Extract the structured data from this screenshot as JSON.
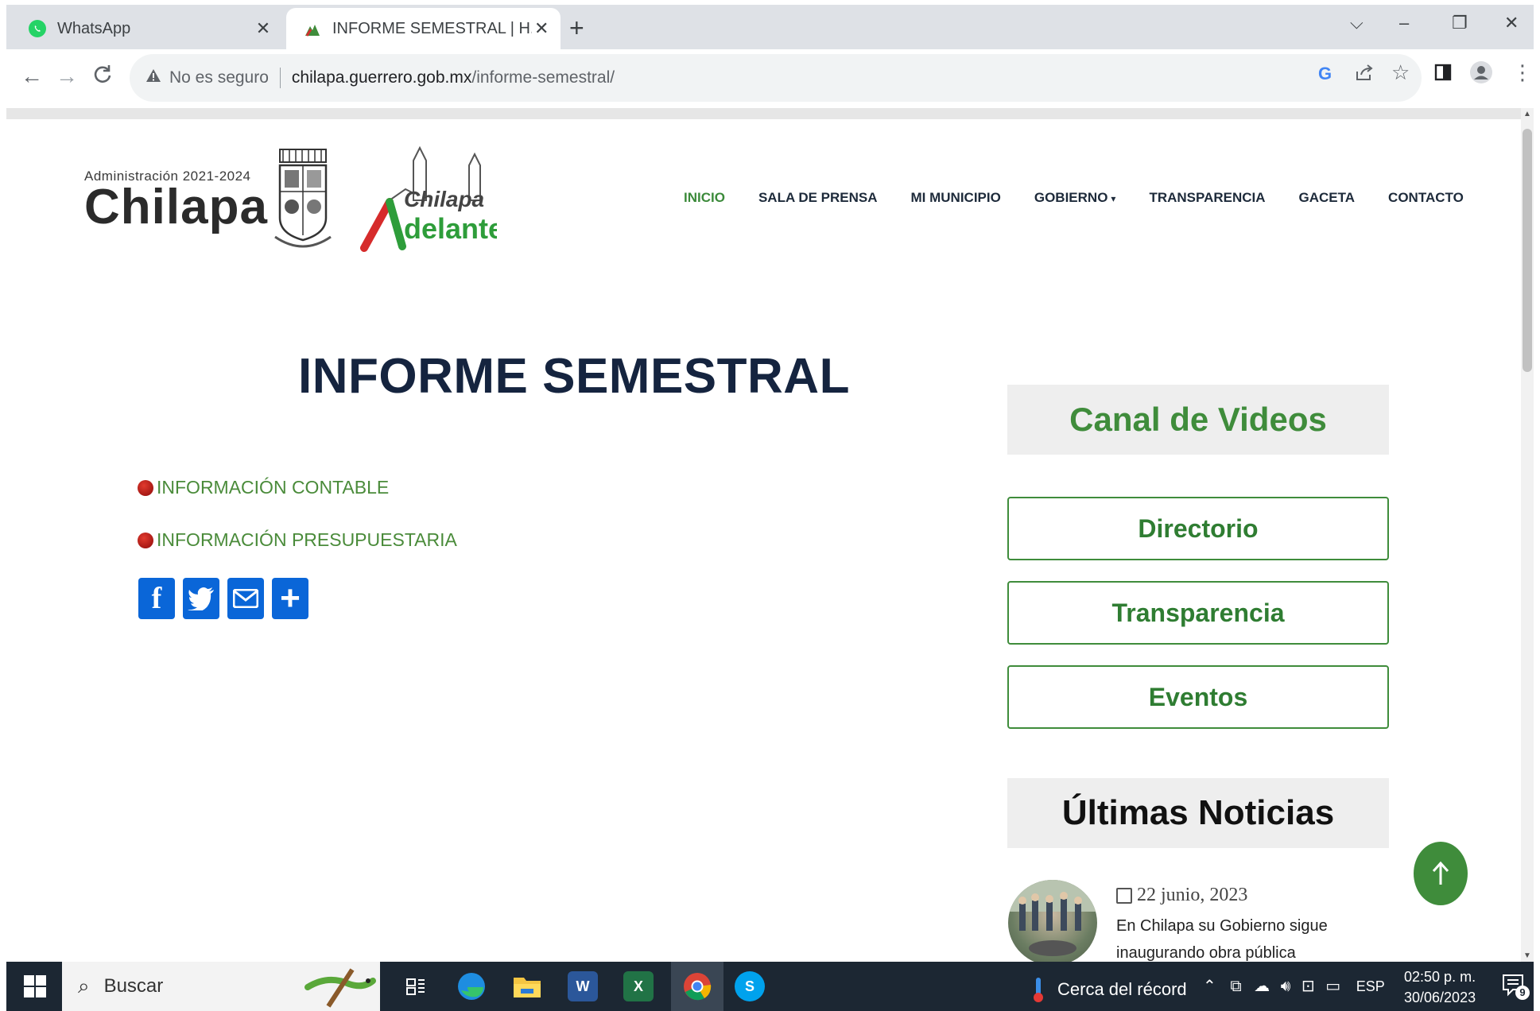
{
  "browser": {
    "tabs": [
      {
        "title": "WhatsApp",
        "close": "✕"
      },
      {
        "title": "INFORME SEMESTRAL | H. Ayunta",
        "close": "✕"
      }
    ],
    "new_tab": "+",
    "window_controls": {
      "dropdown": "⌵",
      "minimize": "–",
      "restore": "❐",
      "close": "✕"
    },
    "nav": {
      "back": "←",
      "forward": "→",
      "reload": "C"
    },
    "omnibox": {
      "security_label": "No es seguro",
      "url_host": "chilapa.guerrero.gob.mx",
      "url_path": "/informe-semestral/"
    },
    "icons": [
      "google-icon",
      "share-icon",
      "star-icon",
      "side-panel-icon",
      "profile-icon",
      "menu-icon"
    ]
  },
  "site": {
    "logo": {
      "admin": "Administración 2021-2024",
      "name": "Chilapa"
    },
    "adelante_logo": {
      "top": "Chilapa",
      "bottom": "delante"
    },
    "nav": [
      {
        "label": "INICIO"
      },
      {
        "label": "SALA DE PRENSA"
      },
      {
        "label": "MI MUNICIPIO"
      },
      {
        "label": "GOBIERNO"
      },
      {
        "label": "TRANSPARENCIA"
      },
      {
        "label": "GACETA"
      },
      {
        "label": "CONTACTO"
      }
    ]
  },
  "content": {
    "title": "INFORME SEMESTRAL",
    "links": [
      {
        "label": "INFORMACIÓN CONTABLE"
      },
      {
        "label": "INFORMACIÓN PRESUPUESTARIA"
      }
    ],
    "share_buttons": [
      {
        "name": "facebook",
        "glyph": "f"
      },
      {
        "name": "twitter",
        "glyph": "t"
      },
      {
        "name": "email",
        "glyph": "✉"
      },
      {
        "name": "share",
        "glyph": "+"
      }
    ]
  },
  "sidebar": {
    "videos_heading": "Canal de Videos",
    "buttons": [
      {
        "label": "Directorio"
      },
      {
        "label": "Transparencia"
      },
      {
        "label": "Eventos"
      }
    ],
    "news_heading": "Últimas Noticias",
    "news": {
      "date": "22 junio, 2023",
      "text": "En Chilapa su Gobierno sigue inaugurando obra pública"
    }
  },
  "taskbar": {
    "search_placeholder": "Buscar",
    "weather": "Cerca del récord",
    "language": "ESP",
    "time": "02:50 p. m.",
    "date": "30/06/2023",
    "notifications": "9"
  },
  "colors": {
    "nav_active": "#3b8a3a",
    "nav_text": "#1d2a3a",
    "title": "#15243f",
    "green": "#3f8c3b",
    "share_blue": "#0a66d8",
    "taskbar": "#1c2733"
  }
}
